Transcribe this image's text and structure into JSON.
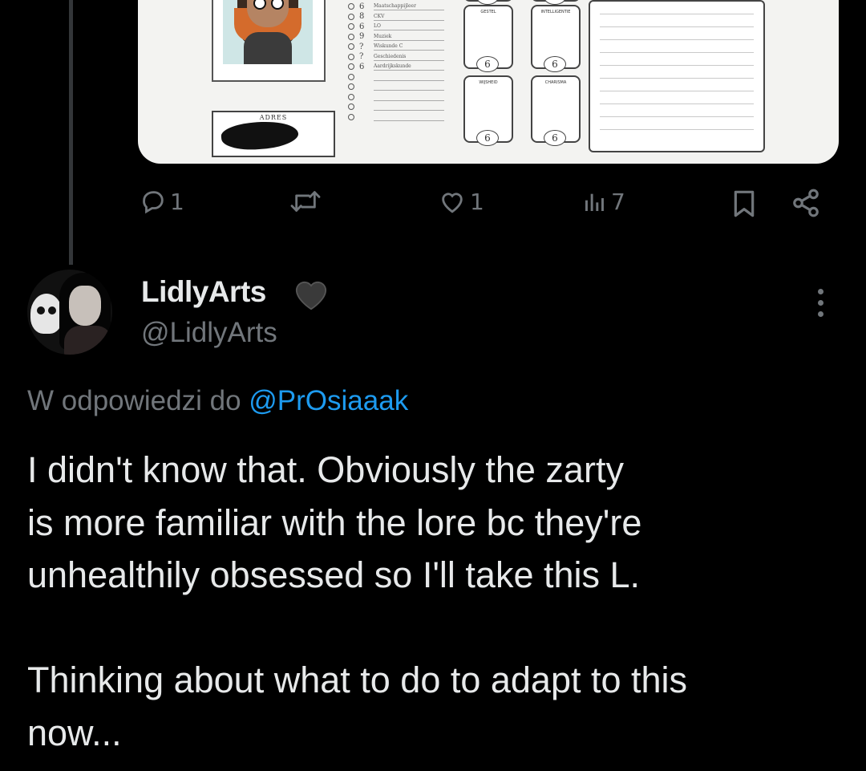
{
  "attached_image": {
    "address_label": "ADRES",
    "stats": [
      {
        "value": "6",
        "label": "Maatschappijleer"
      },
      {
        "value": "8",
        "label": "CKV"
      },
      {
        "value": "6",
        "label": "LO"
      },
      {
        "value": "9",
        "label": "Muziek"
      },
      {
        "value": "?",
        "label": "Wiskunde C"
      },
      {
        "value": "?",
        "label": "Geschiedenis"
      },
      {
        "value": "6",
        "label": "Aardrijkskunde"
      }
    ],
    "abilities": [
      {
        "label": "GESTEL",
        "value": "6"
      },
      {
        "label": "INTELLIGENTIE",
        "value": "6"
      },
      {
        "label": "WIJSHEID",
        "value": "6"
      },
      {
        "label": "CHARISMA",
        "value": "6"
      }
    ],
    "top_values": [
      "6",
      "6"
    ]
  },
  "action_bar": {
    "reply_count": "1",
    "retweet_count": "",
    "like_count": "1",
    "view_count": "7"
  },
  "reply": {
    "display_name": "LidlyArts",
    "badge": "🖤",
    "handle": "@LidlyArts",
    "reply_prefix": "W odpowiedzi do",
    "reply_mention": "@PrOsiaaak",
    "text": "I didn't know that. Obviously the zarty\nis more familiar with the lore bc they're\nunhealthily obsessed so I'll take this L.\n\nThinking about what to do to adapt to this\nnow..."
  },
  "colors": {
    "background": "#000000",
    "text_primary": "#e7e9ea",
    "text_secondary": "#71767b",
    "link": "#1d9bf0"
  },
  "icons": [
    "reply-icon",
    "retweet-icon",
    "like-icon",
    "views-icon",
    "bookmark-icon",
    "share-icon",
    "more-icon",
    "black-heart-icon"
  ]
}
